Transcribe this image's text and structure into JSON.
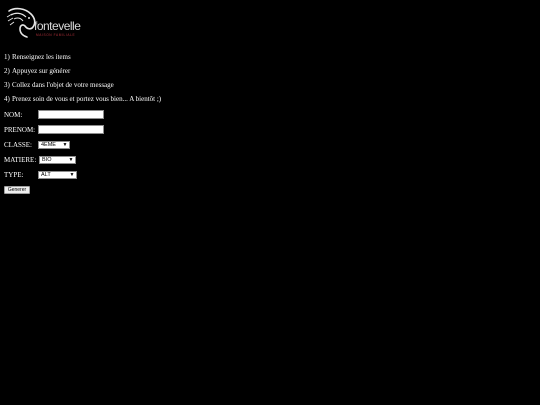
{
  "logo": {
    "name": "fontevelle",
    "tagline": "MAISON FAMILIALE",
    "icon": "horse-head-logo"
  },
  "steps": [
    {
      "num": "1)",
      "text": "Renseignez les items"
    },
    {
      "num": "2)",
      "text": "Appuyez sur générer"
    },
    {
      "num": "3)",
      "text": "Collez dans l'objet de votre message"
    },
    {
      "num": "4)",
      "text": "Prenez soin de vous et portez vous bien... A bientôt ;)"
    }
  ],
  "form": {
    "nom_label": "NOM:",
    "nom_value": "",
    "prenom_label": "PRENOM:",
    "prenom_value": "",
    "classe_label": "CLASSE:",
    "classe_value": "4EME",
    "matiere_label": "MATIERE:",
    "matiere_value": "BIO",
    "type_label": "TYPE:",
    "type_value": "ALT",
    "submit_label": "Generer"
  }
}
